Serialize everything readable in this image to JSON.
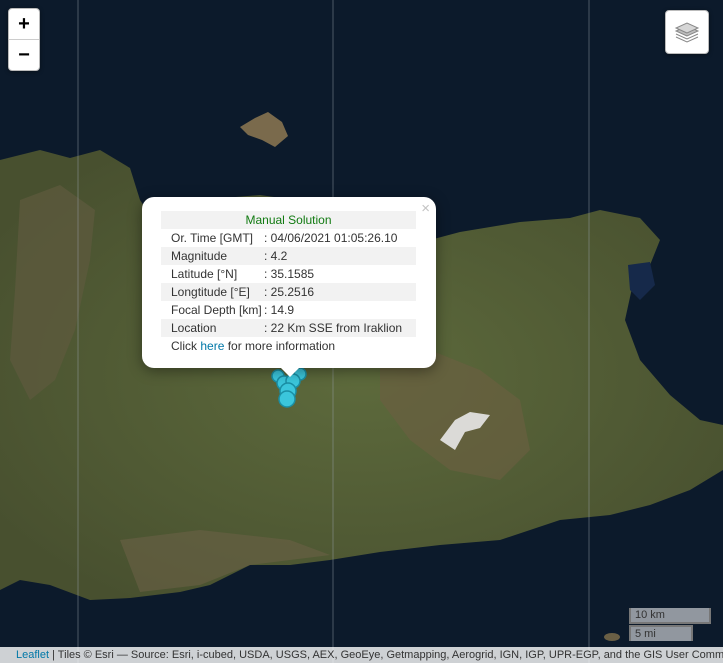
{
  "zoom": {
    "in_label": "+",
    "out_label": "−"
  },
  "popup": {
    "title": "Manual Solution",
    "rows": [
      {
        "label": "Or. Time [GMT]",
        "value": ": 04/06/2021 01:05:26.10"
      },
      {
        "label": "Magnitude",
        "value": ": 4.2"
      },
      {
        "label": "Latitude [°N]",
        "value": ": 35.1585"
      },
      {
        "label": "Longtitude [°E]",
        "value": ": 25.2516"
      },
      {
        "label": "Focal Depth [km]",
        "value": ": 14.9"
      },
      {
        "label": "Location",
        "value": ": 22 Km SSE from Iraklion"
      }
    ],
    "click_prefix": "Click",
    "click_link": "here",
    "click_suffix": "for more information",
    "close": "×"
  },
  "scale": {
    "km": "10 km",
    "mi": "5 mi"
  },
  "attribution": {
    "leaflet": "Leaflet",
    "text": "| Tiles © Esri — Source: Esri, i-cubed, USDA, USGS, AEX, GeoEye, Getmapping, Aerogrid, IGN, IGP, UPR-EGP, and the GIS User Community"
  },
  "colors": {
    "sea": "#0c1a2b",
    "land": "#4f5a35",
    "marker": "#3bc6dc",
    "popup_title": "#117a11",
    "link": "#0078a8"
  },
  "icons": {
    "layers": "layers-icon",
    "marker": "earthquake-marker-icon",
    "close": "close-icon"
  }
}
